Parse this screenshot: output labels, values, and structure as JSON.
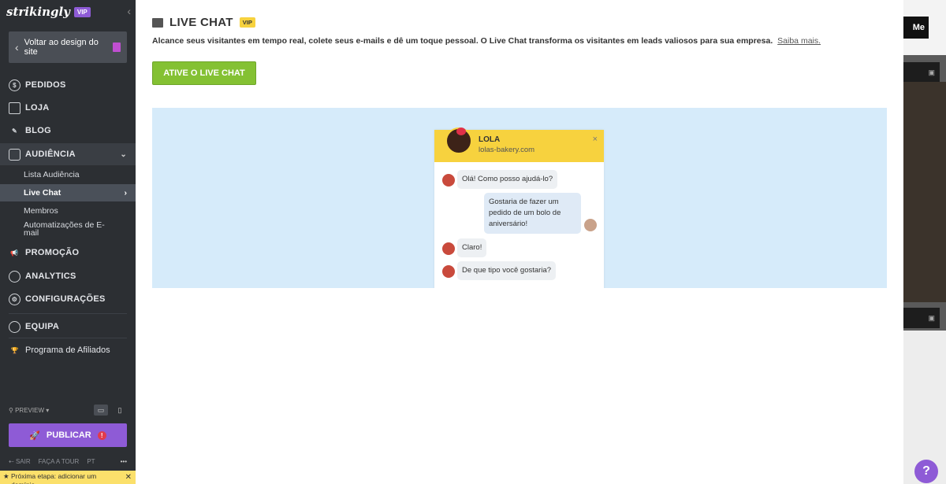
{
  "sidebar": {
    "logo": "strikingly",
    "vip": "VIP",
    "back_label": "Voltar ao design do site",
    "items": {
      "pedidos": "PEDIDOS",
      "loja": "LOJA",
      "blog": "BLOG",
      "audiencia": "AUDIÊNCIA",
      "promocao": "PROMOÇÃO",
      "analytics": "ANALYTICS",
      "configuracoes": "CONFIGURAÇÕES",
      "equipa": "EQUIPA",
      "afiliados": "Programa de Afiliados"
    },
    "audiencia_sub": {
      "lista": "Lista Audiência",
      "livechat": "Live Chat",
      "membros": "Membros",
      "automacoes": "Automatizações de E-mail"
    },
    "preview": "PREVIEW",
    "publish": "PUBLICAR",
    "bottom": {
      "sair": "SAIR",
      "tour": "FAÇA A TOUR",
      "lang": "PT",
      "more": "•••"
    },
    "next_step": "Próxima etapa: adicionar um domínio"
  },
  "main": {
    "title": "LIVE CHAT",
    "vip": "VIP",
    "description": "Alcance seus visitantes em tempo real, colete seus e-mails e dê um toque pessoal. O Live Chat transforma os visitantes em leads valiosos para sua empresa.",
    "learn_more": "Saiba mais.",
    "activate": "ATIVE O LIVE CHAT"
  },
  "widget": {
    "name": "LOLA",
    "url": "lolas-bakery.com",
    "close": "×",
    "messages": {
      "m1": "Olá! Como posso ajudá-lo?",
      "m2": "Gostaria de fazer um pedido de um bolo de aniversário!",
      "m3": "Claro!",
      "m4": "De que tipo você gostaria?"
    }
  },
  "backdrop": {
    "button": "Me",
    "help": "?"
  },
  "colors": {
    "accent": "#8e5bd6",
    "green": "#84c133",
    "yellow": "#f7d23e",
    "preview_bg": "#d6ebfa",
    "sidebar": "#2c2f33"
  }
}
